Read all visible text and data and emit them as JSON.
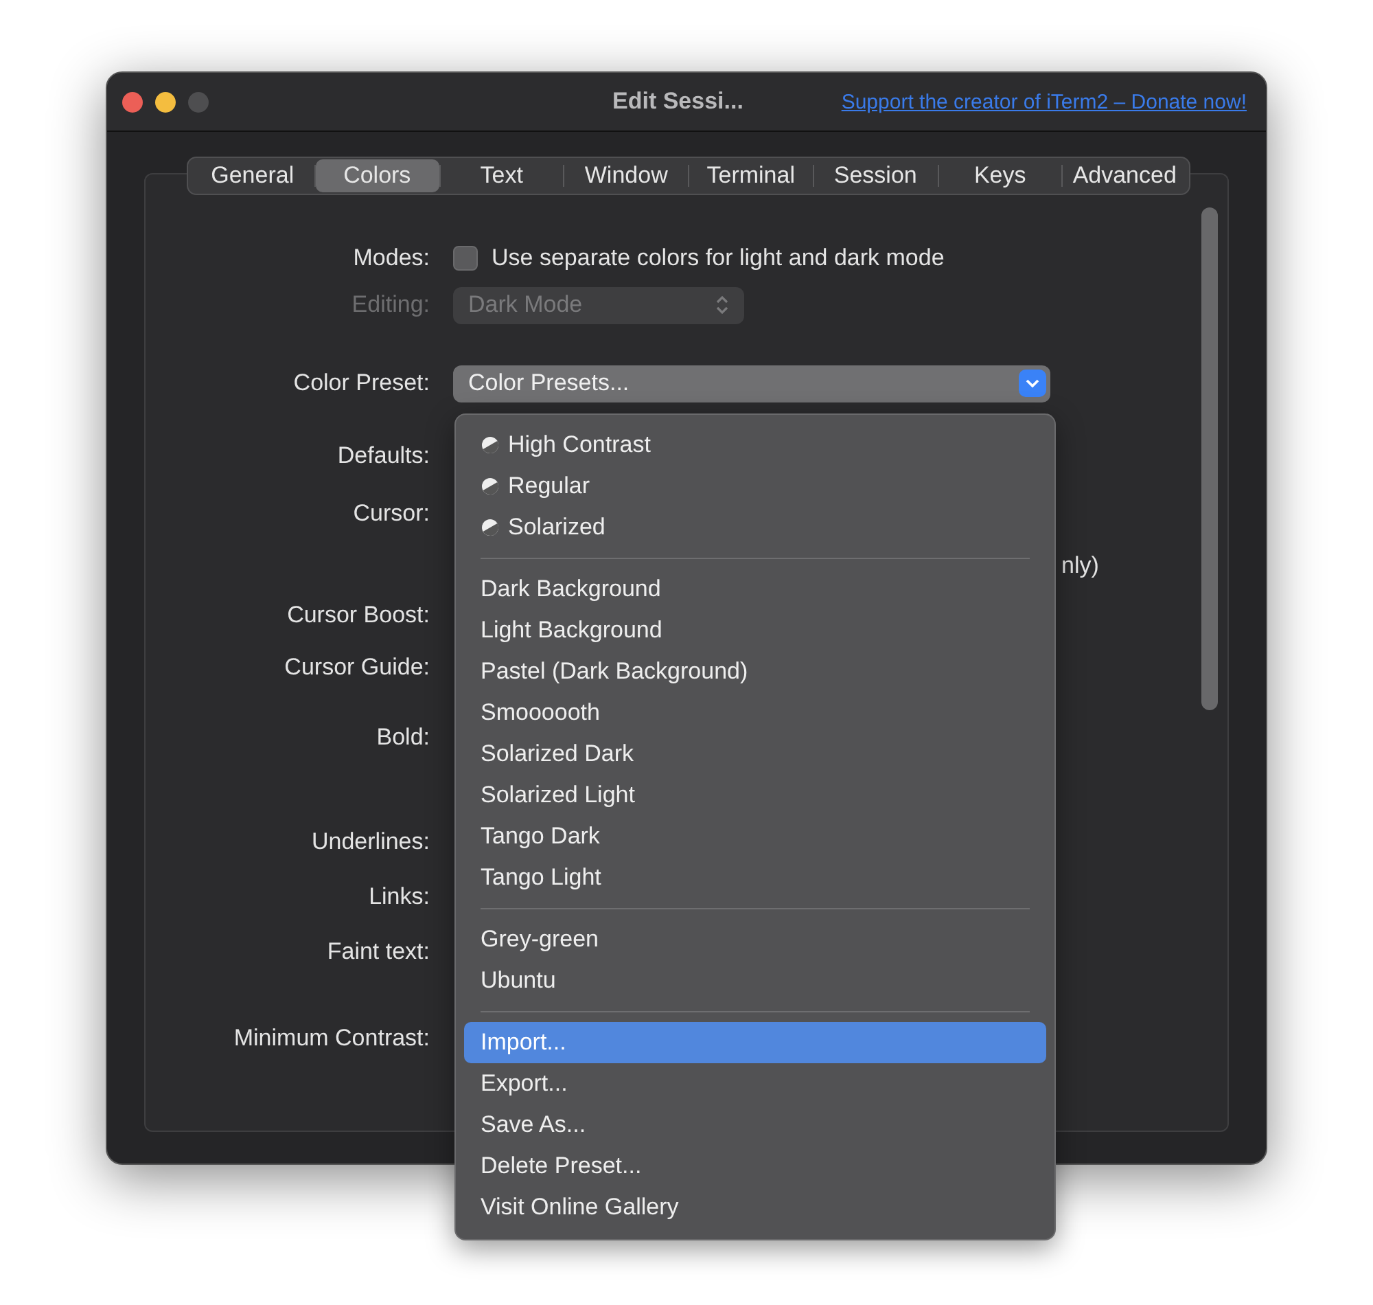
{
  "window": {
    "title": "Edit Sessi...",
    "link": "Support the creator of iTerm2 – Donate now!"
  },
  "tabs": [
    {
      "label": "General",
      "selected": false
    },
    {
      "label": "Colors",
      "selected": true
    },
    {
      "label": "Text",
      "selected": false
    },
    {
      "label": "Window",
      "selected": false
    },
    {
      "label": "Terminal",
      "selected": false
    },
    {
      "label": "Session",
      "selected": false
    },
    {
      "label": "Keys",
      "selected": false
    },
    {
      "label": "Advanced",
      "selected": false
    }
  ],
  "rows": [
    {
      "kind": "checkbox",
      "label": "Modes:",
      "text": "Use separate colors for light and dark mode",
      "checked": false
    },
    {
      "kind": "popup",
      "label": "Editing:",
      "value": "Dark Mode",
      "disabled": true
    },
    {
      "kind": "pulldown",
      "label": "Color Preset:",
      "value": "Color Presets..."
    },
    {
      "kind": "label",
      "label": "Defaults:"
    },
    {
      "kind": "label",
      "label": "Cursor:"
    },
    {
      "kind": "fragment",
      "text": "nly)"
    },
    {
      "kind": "label",
      "label": "Cursor Boost:"
    },
    {
      "kind": "label",
      "label": "Cursor Guide:"
    },
    {
      "kind": "label",
      "label": "Bold:"
    },
    {
      "kind": "label",
      "label": "Underlines:"
    },
    {
      "kind": "label",
      "label": "Links:"
    },
    {
      "kind": "label",
      "label": "Faint text:"
    },
    {
      "kind": "label",
      "label": "Minimum Contrast:"
    }
  ],
  "menu": {
    "groups": [
      [
        {
          "label": "High Contrast",
          "kind": "builtin",
          "selected": false
        },
        {
          "label": "Regular",
          "kind": "builtin",
          "selected": false
        },
        {
          "label": "Solarized",
          "kind": "builtin",
          "selected": false
        }
      ],
      [
        {
          "label": "Dark Background",
          "kind": "plain",
          "selected": false
        },
        {
          "label": "Light Background",
          "kind": "plain",
          "selected": false
        },
        {
          "label": "Pastel (Dark Background)",
          "kind": "plain",
          "selected": false
        },
        {
          "label": "Smoooooth",
          "kind": "plain",
          "selected": false
        },
        {
          "label": "Solarized Dark",
          "kind": "plain",
          "selected": false
        },
        {
          "label": "Solarized Light",
          "kind": "plain",
          "selected": false
        },
        {
          "label": "Tango Dark",
          "kind": "plain",
          "selected": false
        },
        {
          "label": "Tango Light",
          "kind": "plain",
          "selected": false
        }
      ],
      [
        {
          "label": "Grey-green",
          "kind": "plain",
          "selected": false
        },
        {
          "label": "Ubuntu",
          "kind": "plain",
          "selected": false
        }
      ],
      [
        {
          "label": "Import...",
          "kind": "plain",
          "selected": true
        },
        {
          "label": "Export...",
          "kind": "plain",
          "selected": false
        },
        {
          "label": "Save As...",
          "kind": "plain",
          "selected": false
        },
        {
          "label": "Delete Preset...",
          "kind": "plain",
          "selected": false
        },
        {
          "label": "Visit Online Gallery",
          "kind": "plain",
          "selected": false
        }
      ]
    ]
  }
}
